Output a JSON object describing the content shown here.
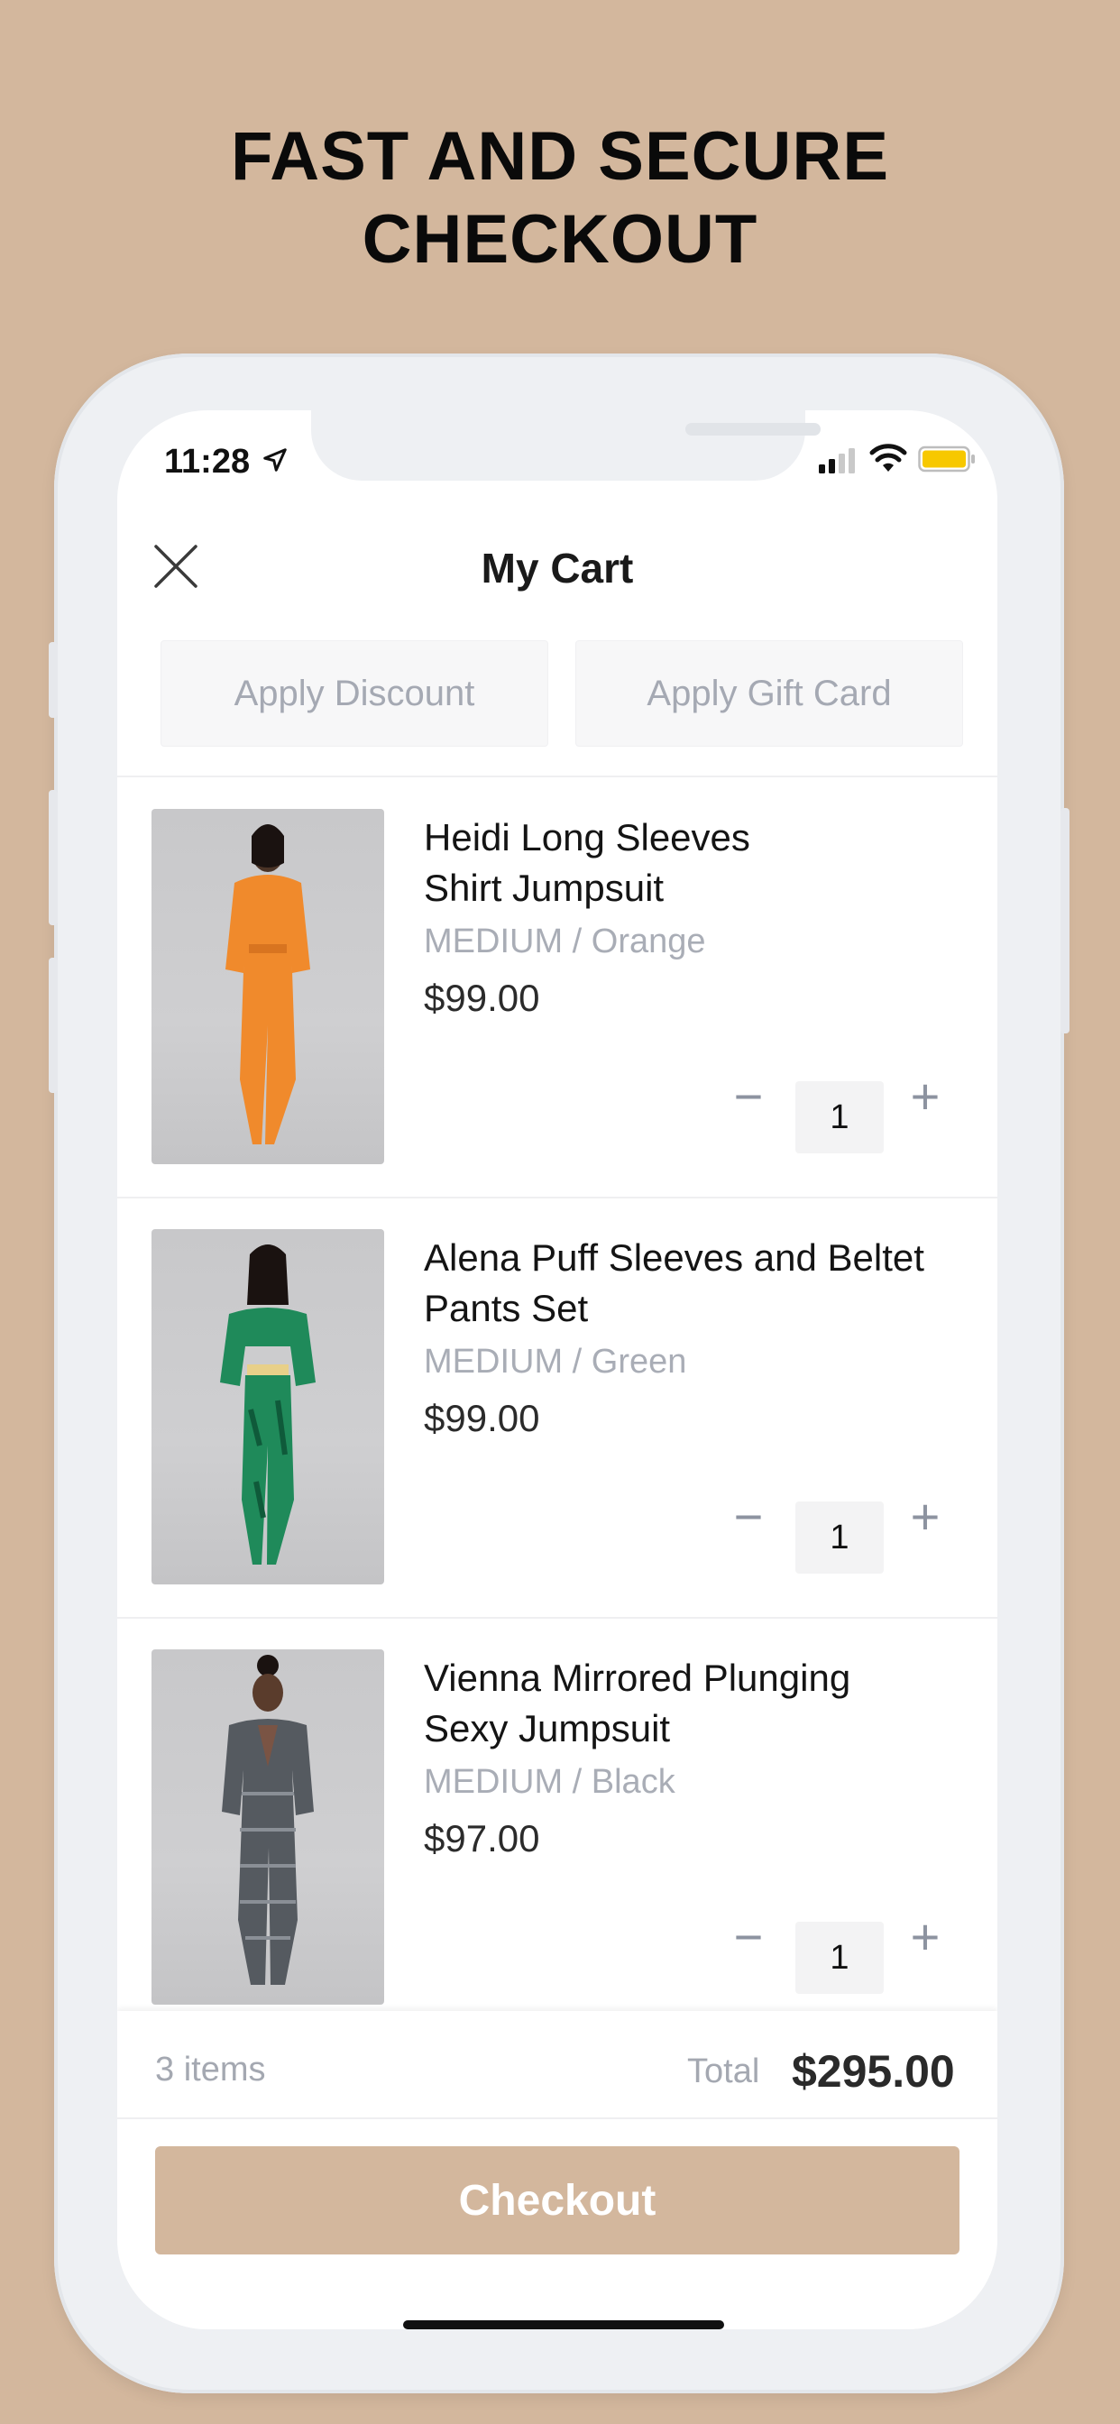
{
  "headline": {
    "line1": "FAST AND SECURE",
    "line2": "CHECKOUT"
  },
  "colors": {
    "brand": "#d3b79d",
    "muted_text": "#a9adb6",
    "battery": "#f7c800"
  },
  "status_bar": {
    "time": "11:28",
    "icons": [
      "location-arrow-icon",
      "signal-icon",
      "wifi-icon",
      "battery-icon"
    ]
  },
  "header": {
    "title": "My Cart",
    "close_icon": "close-icon"
  },
  "actions": {
    "discount": "Apply Discount",
    "gift_card": "Apply Gift Card"
  },
  "items": [
    {
      "name_line1": "Heidi Long Sleeves",
      "name_line2": "Shirt Jumpsuit",
      "variant": "MEDIUM / Orange",
      "price": "$99.00",
      "qty": "1",
      "color": "#f08a2c"
    },
    {
      "name_line1": "Alena Puff Sleeves and Beltet",
      "name_line2": "Pants Set",
      "variant": "MEDIUM / Green",
      "price": "$99.00",
      "qty": "1",
      "color": "#1f8a5a"
    },
    {
      "name_line1": "Vienna Mirrored Plunging",
      "name_line2": "Sexy Jumpsuit",
      "variant": "MEDIUM / Black",
      "price": "$97.00",
      "qty": "1",
      "color": "#555a60"
    }
  ],
  "qty_controls": {
    "minus": "−",
    "plus": "+"
  },
  "footer": {
    "item_count": "3 items",
    "total_label": "Total",
    "total_value": "$295.00",
    "checkout_label": "Checkout"
  }
}
